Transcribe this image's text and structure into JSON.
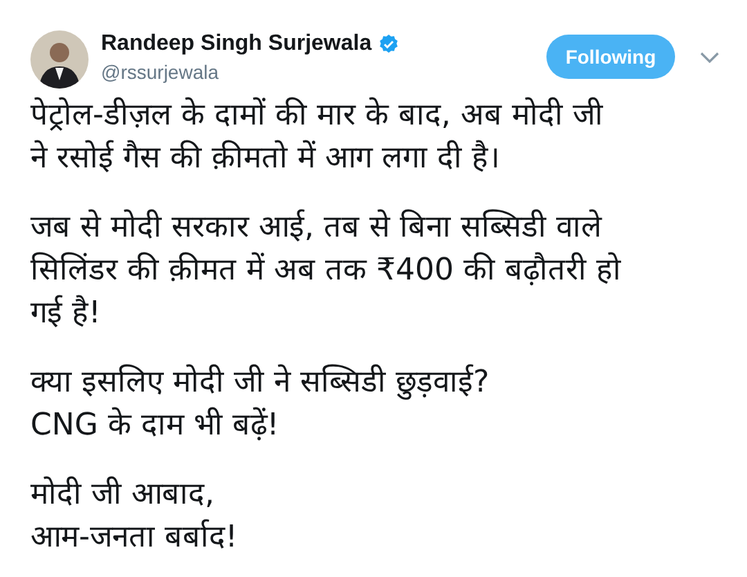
{
  "author": {
    "name": "Randeep Singh Surjewala",
    "verified": true,
    "handle": "@rssurjewala"
  },
  "follow_button": {
    "label": "Following",
    "selected": true
  },
  "tweet_paragraphs": [
    [
      "पेट्रोल-डीज़ल के दामों की मार के बाद, अब मोदी जी",
      "ने रसोई गैस की क़ीमतो में आग लगा दी है।"
    ],
    [
      "जब से मोदी सरकार आई, तब से बिना सब्सिडी वाले",
      "सिलिंडर की क़ीमत में अब तक ₹400 की बढ़ौतरी हो",
      "गई है!"
    ],
    [
      "क्या इसलिए मोदी जी ने सब्सिडी छुड़वाई?",
      "CNG के दाम भी बढ़ें!"
    ],
    [
      "मोदी जी आबाद,",
      "आम-जनता बर्बाद!"
    ]
  ]
}
